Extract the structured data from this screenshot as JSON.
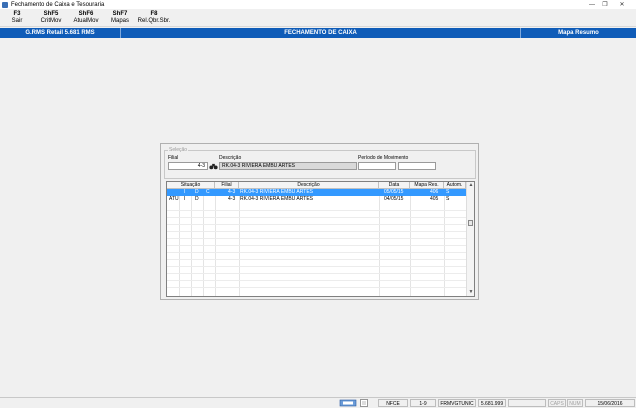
{
  "window": {
    "title": "Fechamento de Caixa e Tesouraria"
  },
  "toolbar": [
    {
      "key": "F3",
      "label": "Sair"
    },
    {
      "key": "ShF5",
      "label": "CritMov"
    },
    {
      "key": "ShF6",
      "label": "AtualMov"
    },
    {
      "key": "ShF7",
      "label": "Mapas"
    },
    {
      "key": "F8",
      "label": "Rel.Qbr.Sbr."
    }
  ],
  "header": {
    "system": "G.RMS Retail 5.681 RMS",
    "screen": "FECHAMENTO DE CAIXA",
    "mode": "Mapa Resumo"
  },
  "selection": {
    "legend": "Seleção",
    "filial_label": "Filial",
    "filial_value": "4-3",
    "descricao_label": "Descrição",
    "descricao_value": "RK.04-3 RIVIERA EMBU ARTES",
    "periodo_label": "Período de Movimento",
    "periodo_from": "",
    "periodo_to": ""
  },
  "grid": {
    "columns": [
      "Situação",
      "Filial",
      "Descrição",
      "Data",
      "Mapa Res.",
      "Autom."
    ],
    "rows": [
      {
        "sit1": "",
        "sit2": "I",
        "sit3": "D",
        "sit4": "C",
        "filial": "4-3",
        "descricao": "RK.04-3 RIVIERA EMBU ARTES",
        "data": "05/05/15",
        "mapa": "406",
        "autom": "S"
      },
      {
        "sit1": "ATU",
        "sit2": "I",
        "sit3": "D",
        "sit4": "",
        "filial": "4-3",
        "descricao": "RK.04-3 RIVIERA EMBU ARTES",
        "data": "04/05/15",
        "mapa": "405",
        "autom": "S"
      }
    ]
  },
  "status": {
    "nfce": "NFCE",
    "page": "1-9",
    "program": "FRMVGTUNIC",
    "version": "5.681.999",
    "caps": "CAPS",
    "num": "NUM",
    "date": "15/06/2016"
  },
  "colors": {
    "header_bar": "#0f5cb8",
    "selection": "#3399ff"
  }
}
